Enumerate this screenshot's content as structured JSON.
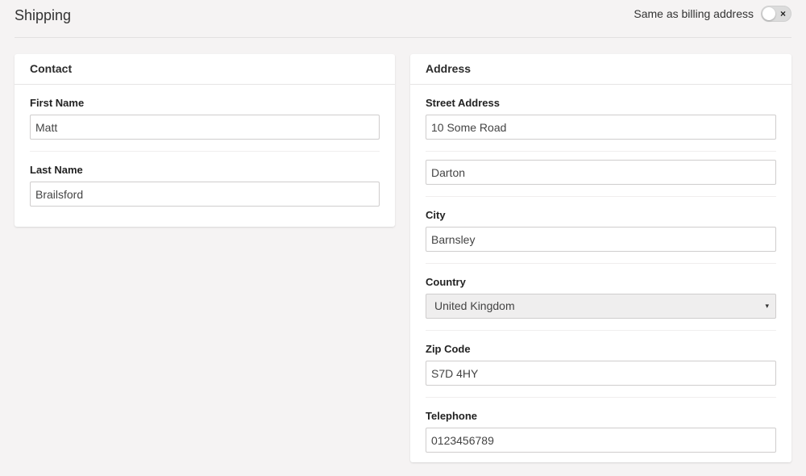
{
  "header": {
    "title": "Shipping",
    "toggle_label": "Same as billing address",
    "toggle_state": "off",
    "toggle_glyph": "×"
  },
  "contact": {
    "title": "Contact",
    "first_name": {
      "label": "First Name",
      "value": "Matt"
    },
    "last_name": {
      "label": "Last Name",
      "value": "Brailsford"
    }
  },
  "address": {
    "title": "Address",
    "street": {
      "label": "Street Address",
      "value": "10 Some Road"
    },
    "street2": {
      "value": "Darton"
    },
    "city": {
      "label": "City",
      "value": "Barnsley"
    },
    "country": {
      "label": "Country",
      "value": "United Kingdom",
      "caret": "▾"
    },
    "zip": {
      "label": "Zip Code",
      "value": "S7D 4HY"
    },
    "telephone": {
      "label": "Telephone",
      "value": "0123456789"
    }
  }
}
